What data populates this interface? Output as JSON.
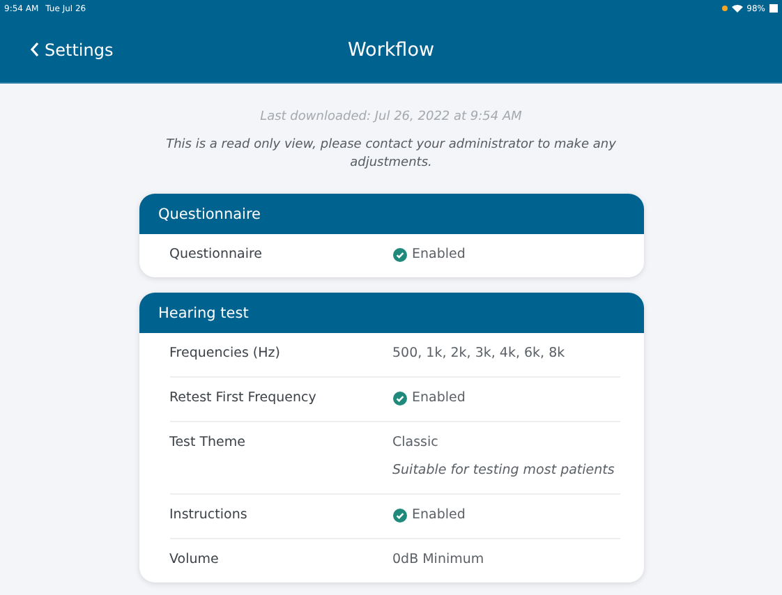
{
  "status_bar": {
    "time": "9:54 AM",
    "date": "Tue Jul 26",
    "battery": "98%"
  },
  "nav": {
    "back": "Settings",
    "title": "Workflow"
  },
  "last_downloaded": "Last downloaded: Jul 26, 2022 at 9:54 AM",
  "notice": "This is a read only view, please contact your administrator to make any adjustments.",
  "sections": [
    {
      "title": "Questionnaire",
      "rows": [
        {
          "label": "Questionnaire",
          "kind": "enabled",
          "value": "Enabled"
        }
      ]
    },
    {
      "title": "Hearing test",
      "rows": [
        {
          "label": "Frequencies (Hz)",
          "kind": "text",
          "value": "500, 1k, 2k, 3k, 4k, 6k, 8k"
        },
        {
          "label": "Retest First Frequency",
          "kind": "enabled",
          "value": "Enabled"
        },
        {
          "label": "Test Theme",
          "kind": "text",
          "value": "Classic",
          "note": "Suitable for testing most patients"
        },
        {
          "label": "Instructions",
          "kind": "enabled",
          "value": "Enabled"
        },
        {
          "label": "Volume",
          "kind": "text",
          "value": "0dB Minimum"
        }
      ]
    }
  ]
}
